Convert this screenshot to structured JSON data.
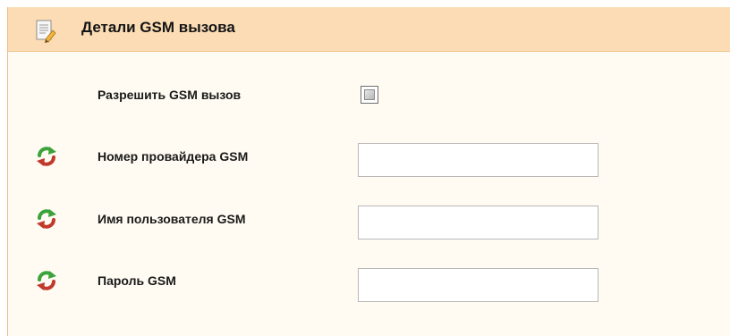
{
  "panel": {
    "title": "Детали GSM вызова",
    "title_icon": "document-edit-icon"
  },
  "rows": [
    {
      "label": "Разрешить GSM вызов",
      "control": "checkbox",
      "checked": false
    },
    {
      "label": "Номер провайдера GSM",
      "control": "text",
      "value": "",
      "icon": "refresh-icon"
    },
    {
      "label": "Имя пользователя GSM",
      "control": "text",
      "value": "",
      "icon": "refresh-icon"
    },
    {
      "label": "Пароль GSM",
      "control": "text",
      "value": "",
      "icon": "refresh-icon"
    }
  ],
  "colors": {
    "header_bg": "#fbdcb5",
    "panel_bg": "#fffaf2",
    "border": "#f0c080",
    "refresh_green": "#3aa33a",
    "refresh_red": "#c0392b"
  }
}
